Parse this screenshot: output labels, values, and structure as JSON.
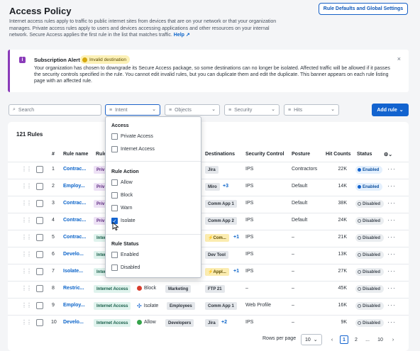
{
  "header": {
    "title": "Access Policy",
    "description": "Internet access rules apply to traffic to public internet sites from devices that are on your network or that your organization manages. Private access rules apply to users and devices accessing applications and other resources on your internal network. Secure Access applies the first rule in the list that matches traffic.",
    "help_label": "Help",
    "defaults_button": "Rule Defaults and Global Settings"
  },
  "alert": {
    "title": "Subscription Alert",
    "badge": "Invalid destination",
    "text": "Your organization has chosen to downgrade its Secure Access package, so some destinations can no longer be isolated. Affected traffic will be allowed if it passes the security controls specified in the rule. You cannot edit invalid rules, but you can duplicate them and edit the duplicate. This banner appears on each rule listing page with an affected rule.",
    "close": "×"
  },
  "filters": {
    "search_placeholder": "Search",
    "intent": "Intent",
    "objects": "Objects",
    "security": "Security",
    "hits": "Hits",
    "add_rule": "Add rule"
  },
  "table": {
    "count_label": "121 Rules",
    "headers": {
      "num": "#",
      "name": "Rule name",
      "rule_short": "Rule",
      "destinations": "Destinations",
      "security": "Security Control",
      "posture": "Posture",
      "hits": "Hit Counts",
      "status": "Status"
    },
    "rows": [
      {
        "num": "1",
        "name": "Contrac...",
        "source": "Priv",
        "dest": "Jira",
        "dest_extra": "",
        "security": "IPS",
        "posture": "Contractors",
        "hits": "22K",
        "status": "Enabled"
      },
      {
        "num": "2",
        "name": "Employ...",
        "source": "Priv",
        "dest": "Miro",
        "dest_extra": "+3",
        "security": "IPS",
        "posture": "Default",
        "hits": "14K",
        "status": "Enabled"
      },
      {
        "num": "3",
        "name": "Contrac...",
        "source": "Priv",
        "dest": "Comm App 1",
        "dest_extra": "",
        "security": "IPS",
        "posture": "Default",
        "hits": "38K",
        "status": "Disabled"
      },
      {
        "num": "4",
        "name": "Contrac...",
        "source": "Priv",
        "dest": "Comm App 2",
        "dest_extra": "",
        "security": "IPS",
        "posture": "Default",
        "hits": "24K",
        "status": "Disabled"
      },
      {
        "num": "5",
        "name": "Contrac...",
        "source": "Inter",
        "dest": "Com...",
        "dest_extra": "+1",
        "security": "IPS",
        "posture": "–",
        "hits": "21K",
        "status": "Disabled"
      },
      {
        "num": "6",
        "name": "Develo...",
        "source": "Inter",
        "dest": "Dev Tool",
        "dest_extra": "",
        "security": "IPS",
        "posture": "–",
        "hits": "13K",
        "status": "Disabled"
      },
      {
        "num": "7",
        "name": "Isolate...",
        "source": "Inter",
        "dest": "Appl...",
        "dest_extra": "+1",
        "security": "IPS",
        "posture": "–",
        "hits": "27K",
        "status": "Disabled"
      },
      {
        "num": "8",
        "name": "Restric...",
        "source": "Internet Access",
        "action": "Block",
        "identity": "Marketing",
        "dest": "FTP 21",
        "dest_extra": "",
        "security": "–",
        "posture": "–",
        "hits": "45K",
        "status": "Disabled"
      },
      {
        "num": "9",
        "name": "Employ...",
        "source": "Internet Access",
        "action": "Isolate",
        "identity": "Employees",
        "dest": "Comm App 1",
        "dest_extra": "",
        "security": "Web Profile",
        "posture": "–",
        "hits": "16K",
        "status": "Disabled"
      },
      {
        "num": "10",
        "name": "Develo...",
        "source": "Internet Access",
        "action": "Allow",
        "identity": "Developers",
        "dest": "Jira",
        "dest_extra": "+2",
        "security": "IPS",
        "posture": "–",
        "hits": "9K",
        "status": "Disabled"
      }
    ]
  },
  "pagination": {
    "rows_label": "Rows per page",
    "rows_value": "10",
    "pages": [
      "1",
      "2",
      "...",
      "10"
    ],
    "current": "1"
  },
  "dropdown": {
    "group_access": "Access",
    "private_access": "Private Access",
    "internet_access": "Internet Access",
    "group_action": "Rule Action",
    "allow": "Allow",
    "block": "Block",
    "warn": "Warn",
    "isolate": "Isolate",
    "group_status": "Rule Status",
    "enabled": "Enabled",
    "disabled": "Disabled"
  },
  "colors": {
    "accent": "#1263cf",
    "alert_purple": "#8a3ab9"
  }
}
